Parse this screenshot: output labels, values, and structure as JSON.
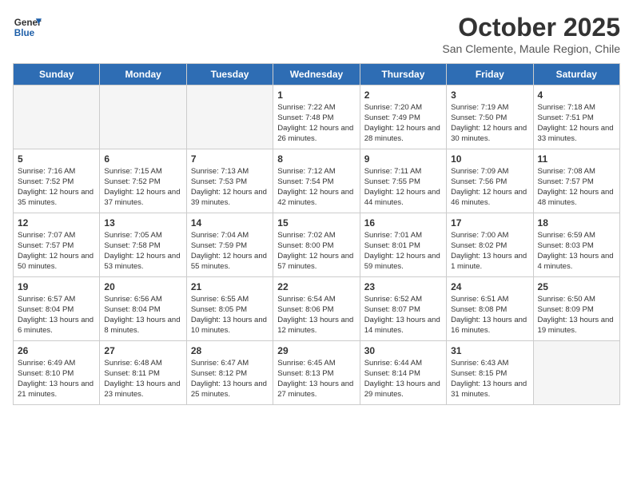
{
  "header": {
    "logo_general": "General",
    "logo_blue": "Blue",
    "month": "October 2025",
    "location": "San Clemente, Maule Region, Chile"
  },
  "weekdays": [
    "Sunday",
    "Monday",
    "Tuesday",
    "Wednesday",
    "Thursday",
    "Friday",
    "Saturday"
  ],
  "weeks": [
    [
      {
        "day": "",
        "empty": true
      },
      {
        "day": "",
        "empty": true
      },
      {
        "day": "",
        "empty": true
      },
      {
        "day": "1",
        "sunrise": "7:22 AM",
        "sunset": "7:48 PM",
        "daylight": "12 hours and 26 minutes."
      },
      {
        "day": "2",
        "sunrise": "7:20 AM",
        "sunset": "7:49 PM",
        "daylight": "12 hours and 28 minutes."
      },
      {
        "day": "3",
        "sunrise": "7:19 AM",
        "sunset": "7:50 PM",
        "daylight": "12 hours and 30 minutes."
      },
      {
        "day": "4",
        "sunrise": "7:18 AM",
        "sunset": "7:51 PM",
        "daylight": "12 hours and 33 minutes."
      }
    ],
    [
      {
        "day": "5",
        "sunrise": "7:16 AM",
        "sunset": "7:52 PM",
        "daylight": "12 hours and 35 minutes."
      },
      {
        "day": "6",
        "sunrise": "7:15 AM",
        "sunset": "7:52 PM",
        "daylight": "12 hours and 37 minutes."
      },
      {
        "day": "7",
        "sunrise": "7:13 AM",
        "sunset": "7:53 PM",
        "daylight": "12 hours and 39 minutes."
      },
      {
        "day": "8",
        "sunrise": "7:12 AM",
        "sunset": "7:54 PM",
        "daylight": "12 hours and 42 minutes."
      },
      {
        "day": "9",
        "sunrise": "7:11 AM",
        "sunset": "7:55 PM",
        "daylight": "12 hours and 44 minutes."
      },
      {
        "day": "10",
        "sunrise": "7:09 AM",
        "sunset": "7:56 PM",
        "daylight": "12 hours and 46 minutes."
      },
      {
        "day": "11",
        "sunrise": "7:08 AM",
        "sunset": "7:57 PM",
        "daylight": "12 hours and 48 minutes."
      }
    ],
    [
      {
        "day": "12",
        "sunrise": "7:07 AM",
        "sunset": "7:57 PM",
        "daylight": "12 hours and 50 minutes."
      },
      {
        "day": "13",
        "sunrise": "7:05 AM",
        "sunset": "7:58 PM",
        "daylight": "12 hours and 53 minutes."
      },
      {
        "day": "14",
        "sunrise": "7:04 AM",
        "sunset": "7:59 PM",
        "daylight": "12 hours and 55 minutes."
      },
      {
        "day": "15",
        "sunrise": "7:02 AM",
        "sunset": "8:00 PM",
        "daylight": "12 hours and 57 minutes."
      },
      {
        "day": "16",
        "sunrise": "7:01 AM",
        "sunset": "8:01 PM",
        "daylight": "12 hours and 59 minutes."
      },
      {
        "day": "17",
        "sunrise": "7:00 AM",
        "sunset": "8:02 PM",
        "daylight": "13 hours and 1 minute."
      },
      {
        "day": "18",
        "sunrise": "6:59 AM",
        "sunset": "8:03 PM",
        "daylight": "13 hours and 4 minutes."
      }
    ],
    [
      {
        "day": "19",
        "sunrise": "6:57 AM",
        "sunset": "8:04 PM",
        "daylight": "13 hours and 6 minutes."
      },
      {
        "day": "20",
        "sunrise": "6:56 AM",
        "sunset": "8:04 PM",
        "daylight": "13 hours and 8 minutes."
      },
      {
        "day": "21",
        "sunrise": "6:55 AM",
        "sunset": "8:05 PM",
        "daylight": "13 hours and 10 minutes."
      },
      {
        "day": "22",
        "sunrise": "6:54 AM",
        "sunset": "8:06 PM",
        "daylight": "13 hours and 12 minutes."
      },
      {
        "day": "23",
        "sunrise": "6:52 AM",
        "sunset": "8:07 PM",
        "daylight": "13 hours and 14 minutes."
      },
      {
        "day": "24",
        "sunrise": "6:51 AM",
        "sunset": "8:08 PM",
        "daylight": "13 hours and 16 minutes."
      },
      {
        "day": "25",
        "sunrise": "6:50 AM",
        "sunset": "8:09 PM",
        "daylight": "13 hours and 19 minutes."
      }
    ],
    [
      {
        "day": "26",
        "sunrise": "6:49 AM",
        "sunset": "8:10 PM",
        "daylight": "13 hours and 21 minutes."
      },
      {
        "day": "27",
        "sunrise": "6:48 AM",
        "sunset": "8:11 PM",
        "daylight": "13 hours and 23 minutes."
      },
      {
        "day": "28",
        "sunrise": "6:47 AM",
        "sunset": "8:12 PM",
        "daylight": "13 hours and 25 minutes."
      },
      {
        "day": "29",
        "sunrise": "6:45 AM",
        "sunset": "8:13 PM",
        "daylight": "13 hours and 27 minutes."
      },
      {
        "day": "30",
        "sunrise": "6:44 AM",
        "sunset": "8:14 PM",
        "daylight": "13 hours and 29 minutes."
      },
      {
        "day": "31",
        "sunrise": "6:43 AM",
        "sunset": "8:15 PM",
        "daylight": "13 hours and 31 minutes."
      },
      {
        "day": "",
        "empty": true
      }
    ]
  ]
}
